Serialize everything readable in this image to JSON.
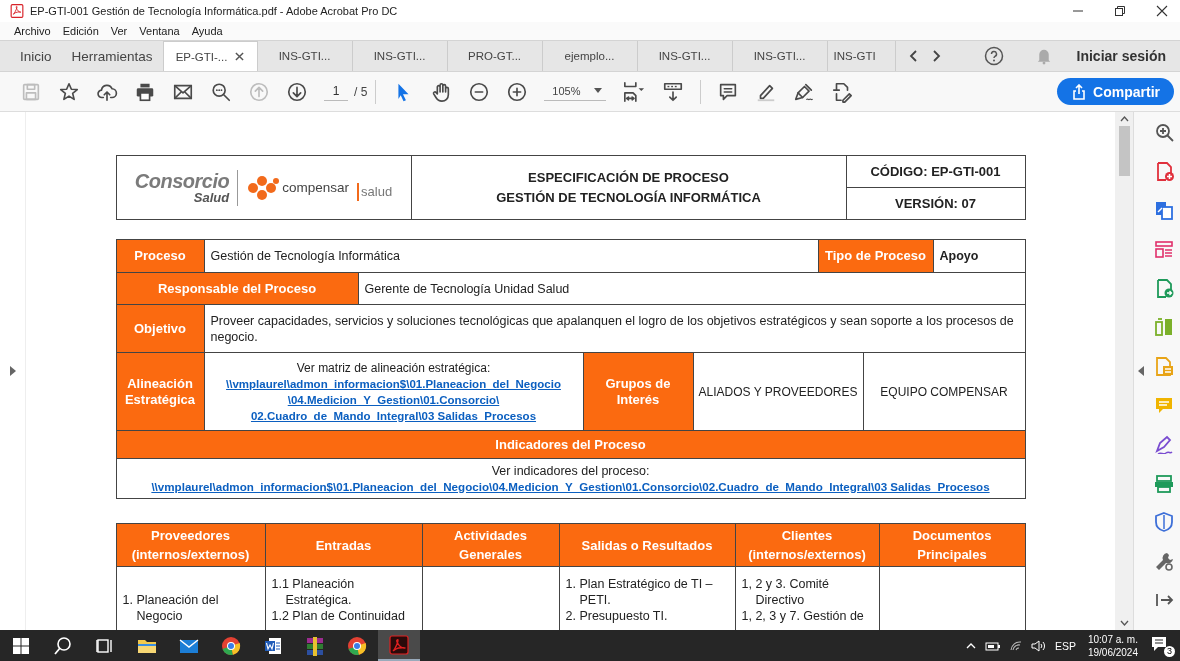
{
  "window": {
    "title": "EP-GTI-001 Gestión de Tecnología Informática.pdf - Adobe Acrobat Pro DC"
  },
  "menu": [
    "Archivo",
    "Edición",
    "Ver",
    "Ventana",
    "Ayuda"
  ],
  "tabs": [
    {
      "label": "Inicio",
      "kind": "home",
      "selected": false
    },
    {
      "label": "Herramientas",
      "kind": "home",
      "selected": false
    },
    {
      "label": "EP-GTI-...",
      "kind": "document",
      "selected": true
    },
    {
      "label": "INS-GTI...",
      "kind": "document",
      "selected": false
    },
    {
      "label": "INS-GTI...",
      "kind": "document",
      "selected": false
    },
    {
      "label": "PRO-GT...",
      "kind": "document",
      "selected": false
    },
    {
      "label": "ejemplo...",
      "kind": "document",
      "selected": false
    },
    {
      "label": "INS-GTI...",
      "kind": "document",
      "selected": false
    },
    {
      "label": "INS-GTI...",
      "kind": "document",
      "selected": false
    },
    {
      "label": "INS-GTI",
      "kind": "document",
      "selected": false
    }
  ],
  "account": {
    "label": "Iniciar sesión"
  },
  "toolbar": {
    "file_tools": [
      {
        "kind": "save",
        "disabled": true
      },
      {
        "kind": "bookmark",
        "disabled": false
      },
      {
        "kind": "upload",
        "disabled": false
      },
      {
        "kind": "print",
        "disabled": false
      },
      {
        "kind": "email",
        "disabled": false
      },
      {
        "kind": "find",
        "disabled": false
      }
    ],
    "page_tools": [
      {
        "kind": "previous_page",
        "disabled": true
      },
      {
        "kind": "next_page",
        "disabled": false
      }
    ],
    "page": {
      "value": "1",
      "total": "/ 5"
    },
    "mode_tools": [
      {
        "kind": "select",
        "selected": true
      },
      {
        "kind": "hand",
        "selected": false
      }
    ],
    "zoom_tools": [
      {
        "kind": "zoom_out",
        "disabled": false
      },
      {
        "kind": "zoom_in",
        "disabled": false
      }
    ],
    "zoom": {
      "value": "105%"
    },
    "view_tools": [
      {
        "kind": "fit_page",
        "disabled": false
      },
      {
        "kind": "scroll_mode",
        "disabled": false
      }
    ],
    "annotate_tools": [
      {
        "kind": "comment",
        "disabled": false
      },
      {
        "kind": "highlight",
        "disabled": false
      },
      {
        "kind": "sign",
        "disabled": false
      },
      {
        "kind": "edit_pdf",
        "disabled": false
      }
    ],
    "share": {
      "label": "Compartir"
    }
  },
  "document": {
    "header": {
      "logo": {
        "name": "Consorcio",
        "subtitle": "Salud"
      },
      "partner_logo": {
        "name": "compensar",
        "suffix": "salud"
      },
      "title": [
        "ESPECIFICACIÓN DE PROCESO",
        "GESTIÓN DE TECNOLOGÍA INFORMÁTICA"
      ],
      "code": "CÓDIGO: EP-GTI-001",
      "version": "VERSIÓN: 07"
    },
    "general": {
      "process_label": "Proceso",
      "process": "Gestión de Tecnología Informática",
      "type_label": "Tipo de Proceso",
      "type": "Apoyo",
      "owner_label": "Responsable del Proceso",
      "owner": "Gerente de Tecnología Unidad Salud",
      "objective_label": "Objetivo",
      "objective": "Proveer capacidades, servicios y soluciones tecnológicas que apalanquen el logro de los objetivos estratégicos y sean soporte a los procesos de negocio.",
      "alignment_label": "Alineación Estratégica",
      "alignment_intro": "Ver matriz de alineación estratégica:",
      "alignment_link": [
        "\\\\vmplaurel\\admon_informacion$\\01.Planeacion_del_Negocio",
        "\\04.Medicion_Y_Gestion\\01.Consorcio\\",
        "02.Cuadro_de_Mando_Integral\\03 Salidas_Procesos"
      ],
      "stakeholders_label": "Grupos de Interés",
      "stakeholders": [
        "ALIADOS Y PROVEEDORES",
        "EQUIPO COMPENSAR"
      ],
      "indicators_title": "Indicadores del Proceso",
      "indicators_intro": "Ver indicadores del proceso:",
      "indicators_link": "\\\\vmplaurel\\admon_informacion$\\01.Planeacion_del_Negocio\\04.Medicion_Y_Gestion\\01.Consorcio\\02.Cuadro_de_Mando_Integral\\03 Salidas_Procesos"
    },
    "sipoc": {
      "columns": [
        "Proveedores (internos/externos)",
        "Entradas",
        "Actividades Generales",
        "Salidas o Resultados",
        "Clientes (internos/externos)",
        "Documentos Principales"
      ],
      "rows": [
        {
          "cells": [
            [
              "1. Planeación del Negocio"
            ],
            [
              "1.1 Planeación Estratégica.",
              "1.2 Plan de Continuidad"
            ],
            null,
            [
              "1. Plan Estratégico de TI – PETI.",
              "2. Presupuesto TI."
            ],
            [
              "1, 2 y 3. Comité Directivo",
              "1, 2, 3 y 7. Gestión de"
            ],
            null
          ]
        }
      ]
    }
  },
  "taskbar": {
    "apps": [
      {
        "kind": "folder",
        "active": false
      },
      {
        "kind": "mail",
        "active": false
      },
      {
        "kind": "browser",
        "active": false
      },
      {
        "kind": "word",
        "active": false
      },
      {
        "kind": "archive",
        "active": false
      },
      {
        "kind": "browser",
        "active": false
      },
      {
        "kind": "pdf",
        "active": true
      }
    ],
    "tray": {
      "language": "ESP",
      "time": "10:07 a. m.",
      "date": "19/06/2024",
      "notifications": "3"
    }
  }
}
